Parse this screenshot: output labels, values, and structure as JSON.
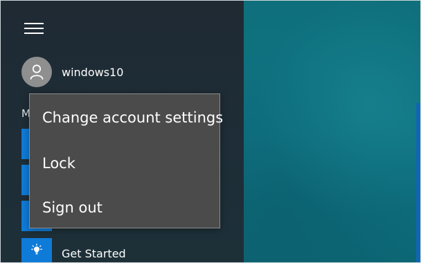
{
  "start": {
    "username": "windows10",
    "section_letter": "M",
    "app_label": "Get Started",
    "menu": {
      "items": [
        {
          "label": "Change account settings"
        },
        {
          "label": "Lock"
        },
        {
          "label": "Sign out"
        }
      ]
    }
  },
  "icons": {
    "hamburger": "hamburger-menu-icon",
    "avatar": "user-icon",
    "app": "lightbulb-icon"
  },
  "colors": {
    "start_background": "#1f2a33",
    "desktop_background": "#0f7282",
    "tile_blue": "#0f7bd8",
    "menu_background": "#4b4b4b",
    "menu_border": "#8c8c8c",
    "avatar": "#8f8f8f"
  }
}
